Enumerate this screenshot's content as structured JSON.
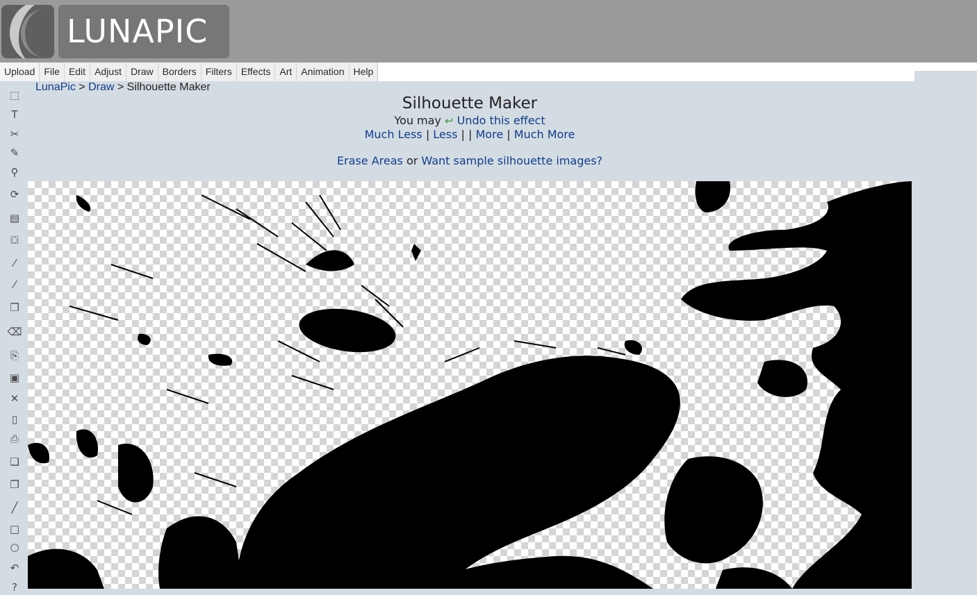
{
  "logo": {
    "text": "LUNAPIC"
  },
  "menu": [
    "Upload",
    "File",
    "Edit",
    "Adjust",
    "Draw",
    "Borders",
    "Filters",
    "Effects",
    "Art",
    "Animation",
    "Help"
  ],
  "toolbar": {
    "tools": [
      {
        "name": "select-icon",
        "glyph": "⬚"
      },
      {
        "name": "text-icon",
        "glyph": "T"
      },
      {
        "name": "scissors-icon",
        "glyph": "✂"
      },
      {
        "name": "pencil-icon",
        "glyph": "✎"
      },
      {
        "name": "zoom-icon",
        "glyph": "⚲"
      },
      {
        "name": "rotate-icon",
        "glyph": "⟳"
      },
      {
        "name": "gradient-icon",
        "glyph": "▤"
      },
      {
        "name": "paint-bucket-icon",
        "glyph": "⛋"
      },
      {
        "name": "eyedropper-icon",
        "glyph": "⁄"
      },
      {
        "name": "brush-icon",
        "glyph": "⁄"
      },
      {
        "name": "layers-icon",
        "glyph": "❐"
      },
      {
        "name": "eraser-icon",
        "glyph": "⌫"
      },
      {
        "name": "open-folder-icon",
        "glyph": "⎘"
      },
      {
        "name": "save-icon",
        "glyph": "▣"
      },
      {
        "name": "close-icon",
        "glyph": "✕"
      },
      {
        "name": "new-file-icon",
        "glyph": "▯"
      },
      {
        "name": "print-icon",
        "glyph": "⎙"
      },
      {
        "name": "copy-icon",
        "glyph": "❏"
      },
      {
        "name": "paste-icon",
        "glyph": "❐"
      },
      {
        "name": "line-icon",
        "glyph": "╱"
      },
      {
        "name": "rectangle-icon",
        "glyph": "□"
      },
      {
        "name": "circle-icon",
        "glyph": "○"
      },
      {
        "name": "undo-icon",
        "glyph": "↶"
      },
      {
        "name": "help-icon",
        "glyph": "?"
      }
    ]
  },
  "breadcrumb": {
    "home": "LunaPic",
    "sep1": " > ",
    "section": "Draw",
    "sep2": " > ",
    "current": "Silhouette Maker"
  },
  "page": {
    "title": "Silhouette Maker",
    "undo_prefix": "You may ",
    "undo_link": "Undo this effect",
    "strength": {
      "much_less": "Much Less",
      "sep1": " | ",
      "less": "Less",
      "sep2": " | | ",
      "more": "More",
      "sep3": " | ",
      "much_more": "Much More"
    },
    "erase_link": "Erase Areas",
    "or_text": " or ",
    "sample_link": "Want sample silhouette images?"
  },
  "colors": {
    "header_bg": "#9a9a9a",
    "page_bg": "#d4dce3",
    "link": "#0f3d8c",
    "undo_icon": "#3a9a3a"
  }
}
